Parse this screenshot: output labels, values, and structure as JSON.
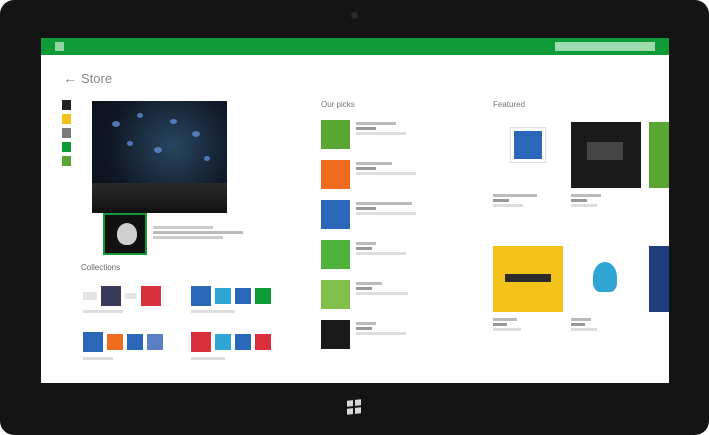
{
  "colors": {
    "accent_green": "#0f9a38",
    "tile_green": "#5aa632",
    "tile_orange": "#ef6b1d",
    "tile_blue": "#2a67b8",
    "tile_red": "#d9303b",
    "tile_yellow": "#f3c21a",
    "tile_cyan": "#2fa5d4"
  },
  "header": {
    "title": "Store",
    "search_placeholder": ""
  },
  "nav": {
    "items": [
      "",
      "",
      "",
      "",
      ""
    ]
  },
  "collections": {
    "title": "Collections"
  },
  "picks": {
    "title": "Our picks"
  },
  "featured": {
    "title": "Featured"
  },
  "icons": [
    "windows-logo-icon",
    "back-arrow-icon",
    "home-icon",
    "search-icon"
  ]
}
